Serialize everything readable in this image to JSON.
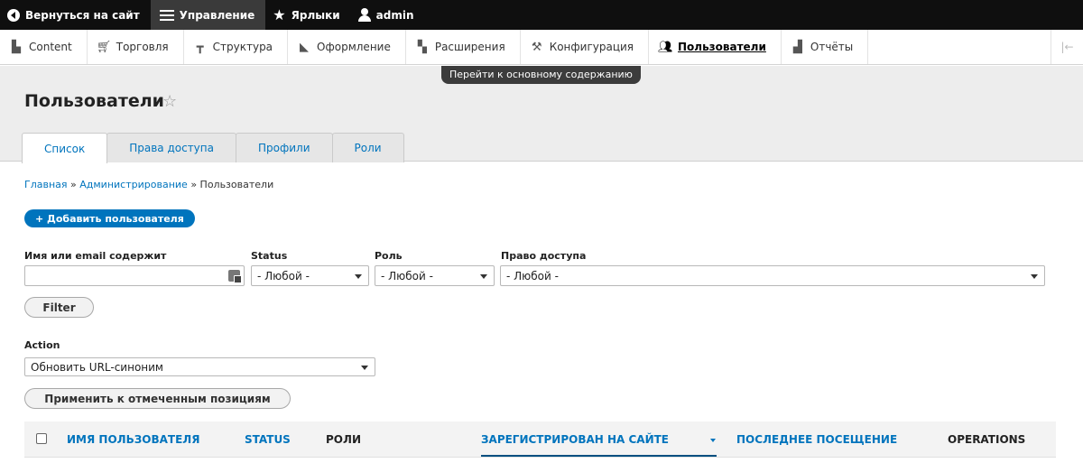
{
  "toolbar": {
    "back": "Вернуться на сайт",
    "manage": "Управление",
    "shortcuts": "Ярлыки",
    "user": "admin"
  },
  "tray": {
    "items": [
      {
        "label": "Content",
        "icon": "file-icon"
      },
      {
        "label": "Торговля",
        "icon": "cart-icon"
      },
      {
        "label": "Структура",
        "icon": "sitemap-icon"
      },
      {
        "label": "Оформление",
        "icon": "paintbrush-icon"
      },
      {
        "label": "Расширения",
        "icon": "puzzle-icon"
      },
      {
        "label": "Конфигурация",
        "icon": "wrench-icon"
      },
      {
        "label": "Пользователи",
        "icon": "people-icon"
      },
      {
        "label": "Отчёты",
        "icon": "bar-chart-icon"
      }
    ],
    "active": "Пользователи"
  },
  "skip_link": "Перейти к основному содержанию",
  "page": {
    "title": "Пользователи"
  },
  "tabs": [
    "Список",
    "Права доступа",
    "Профили",
    "Роли"
  ],
  "breadcrumb": {
    "home": "Главная",
    "sep": "»",
    "admin": "Администрирование",
    "current": "Пользователи"
  },
  "add_button": "+ Добавить пользователя",
  "filters": {
    "name_label": "Имя или email содержит",
    "name_value": "",
    "status_label": "Status",
    "status_value": "- Любой -",
    "role_label": "Роль",
    "role_value": "- Любой -",
    "perm_label": "Право доступа",
    "perm_value": "- Любой -",
    "filter_button": "Filter"
  },
  "action": {
    "label": "Action",
    "value": "Обновить URL-синоним",
    "apply_button": "Применить к отмеченным позициям"
  },
  "table": {
    "columns": [
      "ИМЯ ПОЛЬЗОВАТЕЛЯ",
      "STATUS",
      "РОЛИ",
      "ЗАРЕГИСТРИРОВАН НА САЙТЕ",
      "ПОСЛЕДНЕЕ ПОСЕЩЕНИЕ",
      "OPERATIONS"
    ]
  },
  "colors": {
    "link": "#0074bd",
    "toolbar_bg": "#0f0f0f",
    "header_bg": "#ededed"
  }
}
